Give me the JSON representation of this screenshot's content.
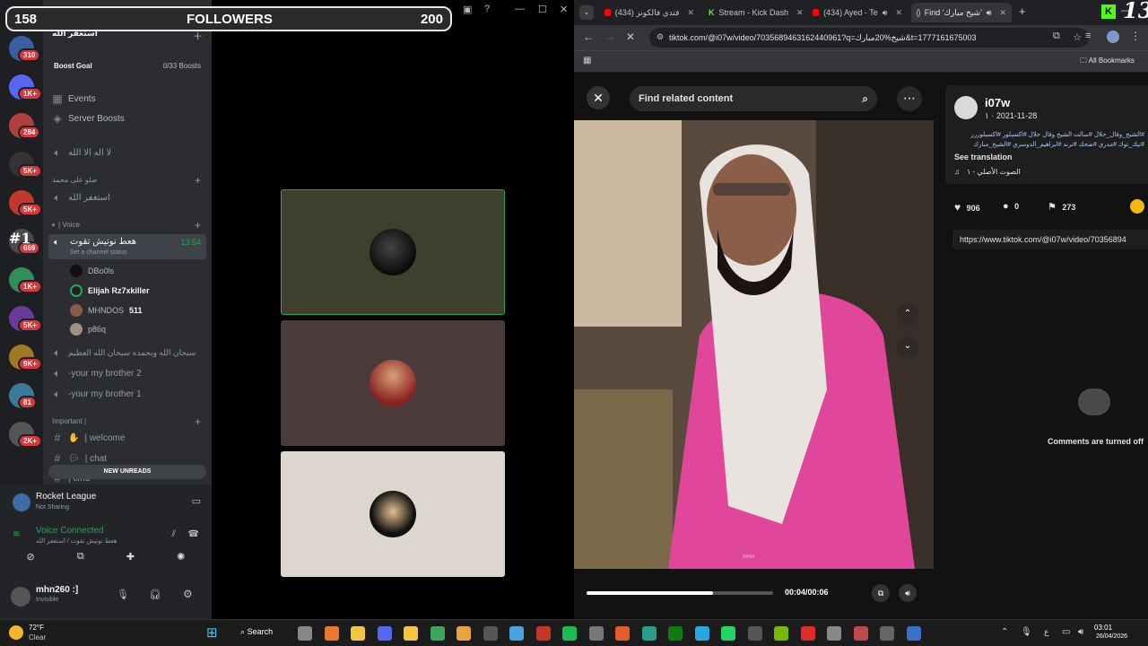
{
  "overlay": {
    "left": "158",
    "label": "FOLLOWERS",
    "right": "200"
  },
  "discord": {
    "guild_badges": [
      "310",
      "1K+",
      "284",
      "5K+",
      "5K+",
      "669",
      "1K+",
      "5K+",
      "9K+",
      "81",
      "2K+"
    ],
    "server_label": "#1",
    "server_header": "استغفر الله",
    "boost_goal": {
      "label": "Boost Goal",
      "value": "0/33 Boosts"
    },
    "menu": [
      {
        "label": "Events",
        "icon": "calendar-icon"
      },
      {
        "label": "Server Boosts",
        "icon": "boost-icon"
      }
    ],
    "channels_top": [
      "لا اله الا الله"
    ],
    "cat_1": "صلو على محمد",
    "cat_1_channel": "استغفر الله",
    "voice_category": "| Voice",
    "active_voice": {
      "name": "هعط نوتيش تقوت",
      "time": "13:54",
      "status": "Set a channel status"
    },
    "voice_users": [
      {
        "name": "DBo0ls",
        "extra": ""
      },
      {
        "name": "Elijah Rz7xkiller",
        "extra": ""
      },
      {
        "name": "MHNDOS",
        "extra": "511"
      },
      {
        "name": "p86q",
        "extra": ""
      }
    ],
    "more_voice": [
      "سبحان الله وبحمده سبحان الله العظيم",
      "-your my brother 2",
      "-your my brother 1"
    ],
    "important_category": "Important |",
    "text_channels": [
      "| welcome",
      "| chat",
      "| cmd"
    ],
    "new_unreads": "NEW UNREADS",
    "activity": {
      "title": "Rocket League",
      "sub": "Not Sharing"
    },
    "voice_connected": {
      "title": "Voice Connected",
      "sub": "هعط نوتيش تقوت / استغفر الله"
    },
    "user": {
      "name": "mhn260 :]",
      "status": "Invisible"
    }
  },
  "chrome": {
    "tabs": [
      {
        "label": "(434) فتدي فالكونز",
        "icon_color": "#ff0000"
      },
      {
        "label": "Stream - Kick Dash",
        "icon_color": "#53fc18"
      },
      {
        "label": "(434) Ayed - Te",
        "icon_color": "#ff0000"
      },
      {
        "label": "Find 'شيخ مبارك'",
        "icon_color": "#888888"
      }
    ],
    "url": "tiktok.com/@i07w/video/7035689463162440961?q=شيخ%20مبارك&t=1777161675003",
    "all_bookmarks": "All Bookmarks",
    "tiktok": {
      "search_placeholder": "Find related content",
      "watermark": "MAR",
      "time": "00:04/00:06",
      "progress": 0.68,
      "author": "i07w",
      "date": "١ · 2021-11-28",
      "caption": "#الشيخ_وقال_حلال #سالت الشيخ وقال حلال #اكسبلور #اكسبلوررر #تيك_توك #مدري #ضحك #ترند #ابراهيم_الدوسري #الشيخ_مبارك",
      "see_translation": "See translation",
      "sound": "الصوت الأصلي - ١",
      "likes": "906",
      "comments": "0",
      "saves": "273",
      "link": "https://www.tiktok.com/@i07w/video/70356894",
      "comments_off": "Comments are turned off"
    }
  },
  "taskbar": {
    "weather_temp": "72°F",
    "weather_cond": "Clear",
    "search": "Search",
    "time": "03:01",
    "date": "26/04/2026"
  },
  "corner_badge": "13"
}
